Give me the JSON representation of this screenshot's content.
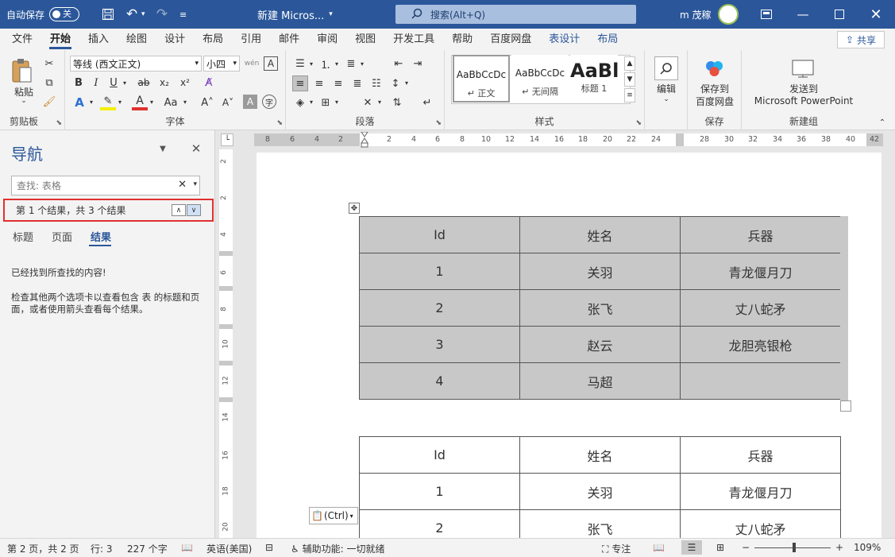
{
  "titlebar": {
    "autosave_label": "自动保存",
    "autosave_state": "关",
    "doc_title": "新建 Micros...",
    "search_placeholder": "搜索(Alt+Q)",
    "user_name": "m 茂稼"
  },
  "tabs": [
    "文件",
    "开始",
    "插入",
    "绘图",
    "设计",
    "布局",
    "引用",
    "邮件",
    "审阅",
    "视图",
    "开发工具",
    "帮助",
    "百度网盘",
    "表设计",
    "布局"
  ],
  "active_tab_index": 1,
  "share_label": "共享",
  "ribbon": {
    "clipboard": {
      "paste_label": "粘贴",
      "group_label": "剪贴板"
    },
    "font": {
      "font_name": "等线 (西文正文)",
      "font_size": "小四",
      "group_label": "字体"
    },
    "paragraph": {
      "group_label": "段落"
    },
    "styles": {
      "group_label": "样式",
      "cards": [
        {
          "preview": "AaBbCcDc",
          "name": "↵ 正文"
        },
        {
          "preview": "AaBbCcDc",
          "name": "↵ 无间隔"
        },
        {
          "preview": "AaBl",
          "name": "标题 1"
        }
      ]
    },
    "editing": {
      "label": "编辑"
    },
    "save": {
      "label_line1": "保存到",
      "label_line2": "百度网盘",
      "group_label": "保存"
    },
    "newgroup": {
      "label_line1": "发送到",
      "label_line2": "Microsoft PowerPoint",
      "group_label": "新建组"
    }
  },
  "nav": {
    "title": "导航",
    "search_value": "查找: 表格",
    "result_text": "第 1 个结果，共 3 个结果",
    "tabs": [
      "标题",
      "页面",
      "结果"
    ],
    "message1": "已经找到所查找的内容!",
    "message2": "检查其他两个选项卡以查看包含 表 的标题和页面，或者使用箭头查看每个结果。"
  },
  "ruler": {
    "h_ticks": [
      "8",
      "6",
      "4",
      "2",
      "2",
      "4",
      "6",
      "8",
      "10",
      "12",
      "14",
      "16",
      "18",
      "20",
      "22",
      "24",
      "28",
      "30",
      "32",
      "34",
      "36",
      "38",
      "40",
      "42"
    ],
    "v_ticks": [
      "2",
      "2",
      "4",
      "6",
      "8",
      "10",
      "12",
      "14",
      "16",
      "18",
      "20"
    ]
  },
  "table1": {
    "headers": [
      "Id",
      "姓名",
      "兵器"
    ],
    "rows": [
      [
        "1",
        "关羽",
        "青龙偃月刀"
      ],
      [
        "2",
        "张飞",
        "丈八蛇矛"
      ],
      [
        "3",
        "赵云",
        "龙胆亮银枪"
      ],
      [
        "4",
        "马超",
        ""
      ]
    ]
  },
  "table2": {
    "headers": [
      "Id",
      "姓名",
      "兵器"
    ],
    "rows": [
      [
        "1",
        "关羽",
        "青龙偃月刀"
      ],
      [
        "2",
        "张飞",
        "丈八蛇矛"
      ]
    ]
  },
  "paste_options": "(Ctrl)",
  "status": {
    "page": "第 2 页，共 2 页",
    "line": "行: 3",
    "words": "227 个字",
    "language": "英语(美国)",
    "accessibility": "辅助功能: 一切就绪",
    "focus": "专注",
    "zoom": "109%"
  }
}
